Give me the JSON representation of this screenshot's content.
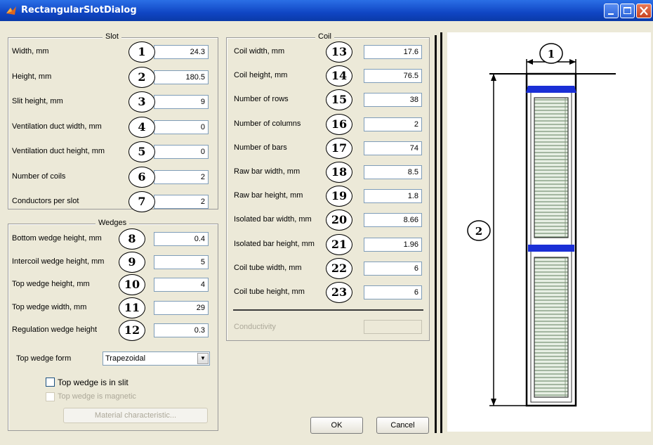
{
  "window": {
    "title": "RectangularSlotDialog"
  },
  "slot": {
    "legend": "Slot",
    "rows": [
      {
        "label": "Width, mm",
        "num": "1",
        "value": "24.3"
      },
      {
        "label": "Height, mm",
        "num": "2",
        "value": "180.5"
      },
      {
        "label": "Slit height, mm",
        "num": "3",
        "value": "9"
      },
      {
        "label": "Ventilation duct width, mm",
        "num": "4",
        "value": "0"
      },
      {
        "label": "Ventilation duct height, mm",
        "num": "5",
        "value": "0"
      },
      {
        "label": "Number of coils",
        "num": "6",
        "value": "2"
      },
      {
        "label": "Conductors per slot",
        "num": "7",
        "value": "2"
      }
    ]
  },
  "wedges": {
    "legend": "Wedges",
    "rows": [
      {
        "label": "Bottom wedge height, mm",
        "num": "8",
        "value": "0.4"
      },
      {
        "label": "Intercoil wedge height, mm",
        "num": "9",
        "value": "5"
      },
      {
        "label": "Top wedge height, mm",
        "num": "10",
        "value": "4"
      },
      {
        "label": "Top wedge width, mm",
        "num": "11",
        "value": "29"
      },
      {
        "label": "Regulation wedge height",
        "num": "12",
        "value": "0.3"
      }
    ],
    "form_label": "Top wedge form",
    "form_value": "Trapezoidal",
    "in_slit_label": "Top wedge is in slit",
    "magnetic_label": "Top wedge is magnetic",
    "material_button": "Material characteristic..."
  },
  "coil": {
    "legend": "Coil",
    "rows": [
      {
        "label": "Coil width, mm",
        "num": "13",
        "value": "17.6"
      },
      {
        "label": "Coil height, mm",
        "num": "14",
        "value": "76.5"
      },
      {
        "label": "Number of rows",
        "num": "15",
        "value": "38"
      },
      {
        "label": "Number of columns",
        "num": "16",
        "value": "2"
      },
      {
        "label": "Number of bars",
        "num": "17",
        "value": "74"
      },
      {
        "label": "Raw bar width, mm",
        "num": "18",
        "value": "8.5"
      },
      {
        "label": "Raw bar height, mm",
        "num": "19",
        "value": "1.8"
      },
      {
        "label": "Isolated bar width, mm",
        "num": "20",
        "value": "8.66"
      },
      {
        "label": "Isolated bar height, mm",
        "num": "21",
        "value": "1.96"
      },
      {
        "label": "Coil tube width, mm",
        "num": "22",
        "value": "6"
      },
      {
        "label": "Coil tube height, mm",
        "num": "23",
        "value": "6"
      }
    ],
    "conductivity_label": "Conductivity",
    "conductivity_value": ""
  },
  "buttons": {
    "ok": "OK",
    "cancel": "Cancel"
  },
  "drawing": {
    "width_marker": "1",
    "height_marker": "2"
  },
  "colors": {
    "title_bar": "#1046c4",
    "wedge_blue": "#1a2fd6",
    "coil_green": "#a9c7a6"
  }
}
